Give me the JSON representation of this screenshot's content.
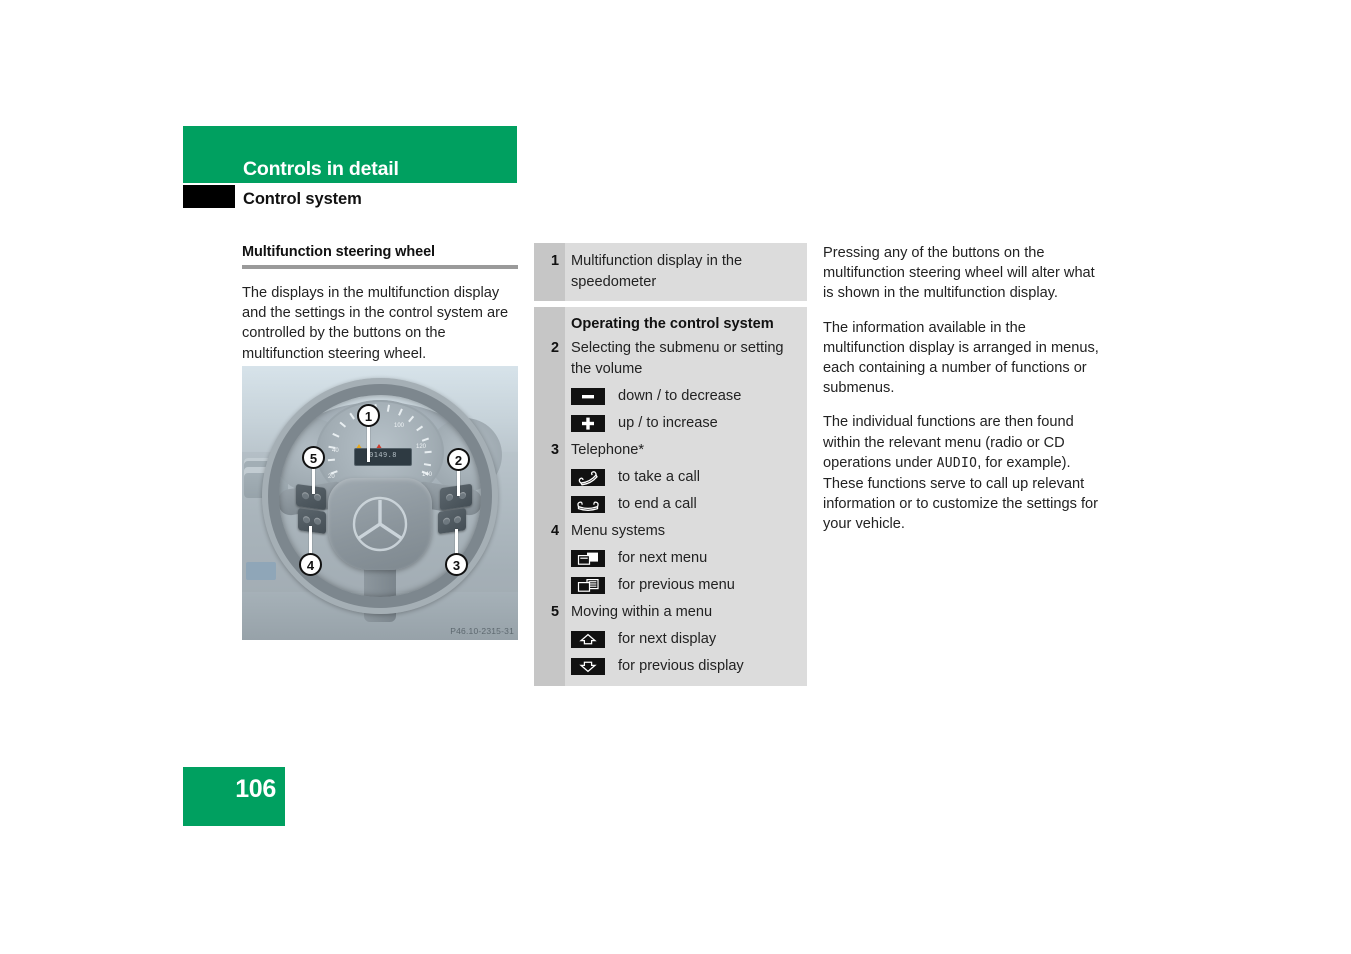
{
  "header": {
    "chapter_title": "Controls in detail",
    "section_title": "Control system",
    "accent_color": "#00A060"
  },
  "left_column": {
    "heading": "Multifunction steering wheel",
    "body": "The displays in the multifunction display and the settings in the control system are controlled by the buttons on the multifunction steering wheel.",
    "figure": {
      "caption": "P46.10-2315-31",
      "display_value": "0149.8",
      "callouts": [
        "1",
        "2",
        "3",
        "4",
        "5"
      ],
      "speed_ticks": [
        "20",
        "40",
        "80",
        "100",
        "120",
        "140"
      ]
    }
  },
  "legend": {
    "items": [
      {
        "number": "1",
        "text": "Multifunction display in the speedometer"
      }
    ],
    "subheading": "Operating the control system",
    "groups": [
      {
        "number": "2",
        "text": "Selecting the submenu or setting the volume",
        "actions": [
          {
            "icon": "minus-icon",
            "label": "down / to decrease"
          },
          {
            "icon": "plus-icon",
            "label": "up / to increase"
          }
        ]
      },
      {
        "number": "3",
        "text": "Telephone*",
        "actions": [
          {
            "icon": "phone-take-call-icon",
            "label": "to take a call"
          },
          {
            "icon": "phone-end-call-icon",
            "label": "to end a call"
          }
        ]
      },
      {
        "number": "4",
        "text": "Menu systems",
        "actions": [
          {
            "icon": "next-menu-icon",
            "label": "for next menu"
          },
          {
            "icon": "previous-menu-icon",
            "label": "for previous menu"
          }
        ]
      },
      {
        "number": "5",
        "text": "Moving within a menu",
        "actions": [
          {
            "icon": "arrow-up-icon",
            "label": "for next display"
          },
          {
            "icon": "arrow-down-icon",
            "label": "for previous display"
          }
        ]
      }
    ]
  },
  "right_column": {
    "paragraph_1": "Pressing any of the buttons on the multifunction steering wheel will alter what is shown in the multifunction display.",
    "paragraph_2": "The information available in the multifunction display is arranged in menus, each containing a number of functions or submenus.",
    "paragraph_3_part_1": "The individual functions are then found within the relevant menu (radio or CD operations under ",
    "paragraph_3_mono": "AUDIO",
    "paragraph_3_part_2": ", for example). These functions serve to call up relevant information or to customize the settings for your vehicle."
  },
  "footer": {
    "page_number": "106"
  }
}
